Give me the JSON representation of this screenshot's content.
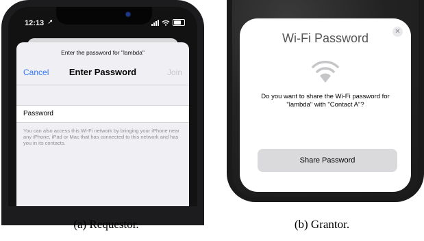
{
  "requestor": {
    "status": {
      "time": "12:13"
    },
    "sheet": {
      "prompt": "Enter the password for \"lambda\"",
      "nav": {
        "cancel": "Cancel",
        "title": "Enter Password",
        "join": "Join"
      },
      "password_label": "Password",
      "footer": "You can also access this Wi-Fi network by bringing your iPhone near any iPhone, iPad or Mac that has connected to this network and has you in its contacts."
    }
  },
  "grantor": {
    "dialog": {
      "title": "Wi-Fi Password",
      "message": "Do you want to share the Wi-Fi password for \"lambda\" with \"Contact A\"?",
      "button": "Share Password"
    }
  },
  "captions": {
    "a": "(a) Requestor.",
    "b": "(b) Grantor."
  },
  "icons": {
    "status_arrow": "location-arrow-icon",
    "signal": "signal-bars-icon",
    "wifi_status": "wifi-icon",
    "battery": "battery-icon",
    "close": "close-icon",
    "wifi_large": "wifi-icon"
  },
  "colors": {
    "accent_blue": "#3478f6",
    "join_disabled": "#c7c7cc",
    "button_gray": "#dadadd"
  }
}
